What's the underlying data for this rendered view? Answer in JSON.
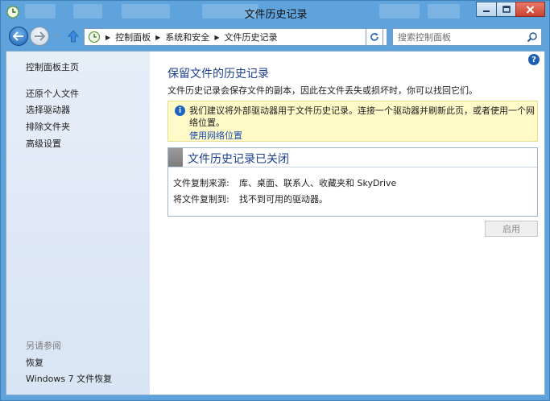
{
  "window": {
    "title": "文件历史记录"
  },
  "address": {
    "crumbs": [
      "控制面板",
      "系统和安全",
      "文件历史记录"
    ],
    "search_placeholder": "搜索控制面板"
  },
  "sidebar": {
    "home": "控制面板主页",
    "links": [
      "还原个人文件",
      "选择驱动器",
      "排除文件夹",
      "高级设置"
    ],
    "see_also_heading": "另请参阅",
    "see_also": [
      "恢复",
      "Windows 7 文件恢复"
    ]
  },
  "main": {
    "title": "保留文件的历史记录",
    "description": "文件历史记录会保存文件的副本，因此在文件丢失或损坏时，你可以找回它们。",
    "notice": {
      "message": "我们建议将外部驱动器用于文件历史记录。连接一个驱动器并刷新此页，或者使用一个网络位置。",
      "link": "使用网络位置"
    },
    "status": {
      "heading": "文件历史记录已关闭",
      "copy_from_label": "文件复制来源:",
      "copy_from_value": "库、桌面、联系人、收藏夹和 SkyDrive",
      "copy_to_label": "将文件复制到:",
      "copy_to_value": "找不到可用的驱动器。"
    },
    "enable_button": "启用"
  },
  "colors": {
    "link": "#1b3f8c",
    "notice_bg": "#fffac8",
    "sidebar_bg": "#e6eef8",
    "frame": "#5ea3dc"
  }
}
